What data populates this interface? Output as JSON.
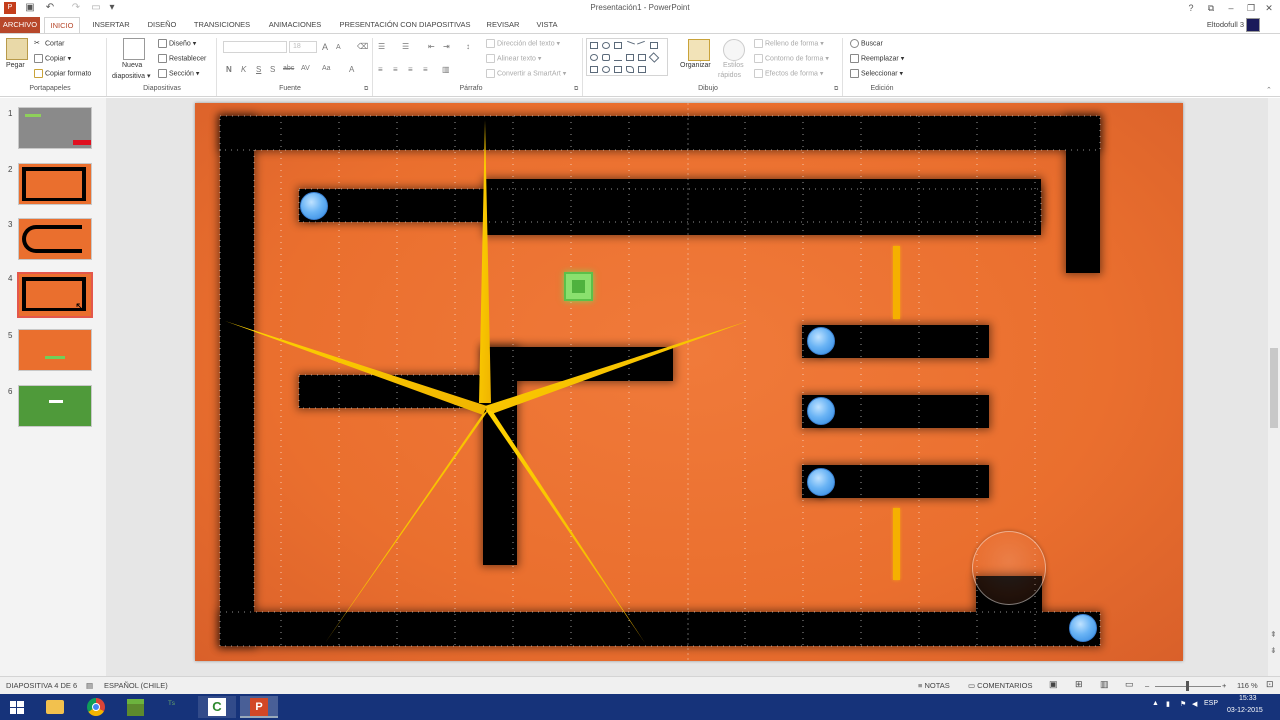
{
  "window": {
    "title": "Presentación1 - PowerPoint",
    "user": "Eltodofull 3",
    "controls": [
      "?",
      "⧉",
      "–",
      "❐",
      "✕"
    ]
  },
  "tabs": [
    "ARCHIVO",
    "INICIO",
    "INSERTAR",
    "DISEÑO",
    "TRANSICIONES",
    "ANIMACIONES",
    "PRESENTACIÓN CON DIAPOSITIVAS",
    "REVISAR",
    "VISTA"
  ],
  "active_tab": "INICIO",
  "ribbon": {
    "portapapeles": {
      "label": "Portapapeles",
      "paste": "Pegar",
      "cut": "Cortar",
      "copy": "Copiar",
      "format_painter": "Copiar formato"
    },
    "diapositivas": {
      "label": "Diapositivas",
      "new_slide_1": "Nueva",
      "new_slide_2": "diapositiva",
      "layout": "Diseño",
      "reset": "Restablecer",
      "section": "Sección"
    },
    "fuente": {
      "label": "Fuente",
      "font_size": "18",
      "bold": "N",
      "italic": "K",
      "underline": "S",
      "strike": "S",
      "charspace": "abc",
      "spacing": "AV",
      "case": "Aa",
      "color": "A",
      "grow": "A",
      "shrink": "A"
    },
    "parrafo": {
      "label": "Párrafo",
      "text_direction": "Dirección del texto",
      "align_text": "Alinear texto",
      "smartart": "Convertir a SmartArt"
    },
    "dibujo": {
      "label": "Dibujo",
      "arrange": "Organizar",
      "quick_styles_1": "Estilos",
      "quick_styles_2": "rápidos",
      "shape_fill": "Relleno de forma",
      "shape_outline": "Contorno de forma",
      "shape_effects": "Efectos de forma"
    },
    "edicion": {
      "label": "Edición",
      "find": "Buscar",
      "replace": "Reemplazar",
      "select": "Seleccionar"
    }
  },
  "thumbnails": [
    {
      "num": "1",
      "bg": "#8a8a8a",
      "selected": false
    },
    {
      "num": "2",
      "bg": "#ea6f2e",
      "selected": false
    },
    {
      "num": "3",
      "bg": "#ea6f2e",
      "selected": false
    },
    {
      "num": "4",
      "bg": "#ea6f2e",
      "selected": true
    },
    {
      "num": "5",
      "bg": "#ea6f2e",
      "selected": false
    },
    {
      "num": "6",
      "bg": "#4f9a3a",
      "selected": false
    }
  ],
  "status": {
    "slide_info": "DIAPOSITIVA 4 DE 6",
    "language": "ESPAÑOL (CHILE)",
    "notes": "NOTAS",
    "comments": "COMENTARIOS",
    "zoom": "116 %"
  },
  "taskbar": {
    "lang": "ESP",
    "time": "15:33",
    "date": "03-12-2015"
  },
  "colors": {
    "accent": "#b7472a",
    "slide_bg": "#ea6f2e",
    "ball": "#5aaaf0",
    "star": "#f5c400",
    "goal": "#5cc04a"
  }
}
